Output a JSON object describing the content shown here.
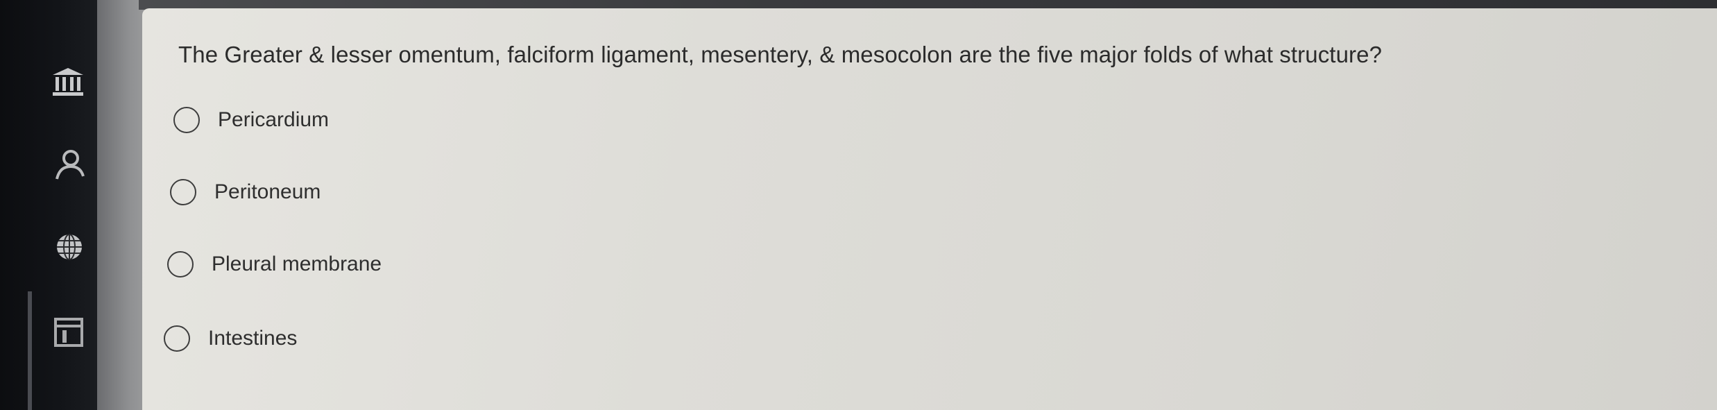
{
  "quiz": {
    "question": "The Greater & lesser omentum, falciform ligament, mesentery, & mesocolon are the five major folds of what structure?",
    "options": [
      {
        "label": "Pericardium",
        "selected": false
      },
      {
        "label": "Peritoneum",
        "selected": false
      },
      {
        "label": "Pleural membrane",
        "selected": false
      },
      {
        "label": "Intestines",
        "selected": false
      }
    ]
  },
  "nav": {
    "icons": [
      "institution-icon",
      "account-icon",
      "globe-icon",
      "calendar-icon"
    ]
  },
  "colors": {
    "card_background": "#deddd8",
    "text": "#2b2b2b",
    "nav_rail": "#121418"
  }
}
